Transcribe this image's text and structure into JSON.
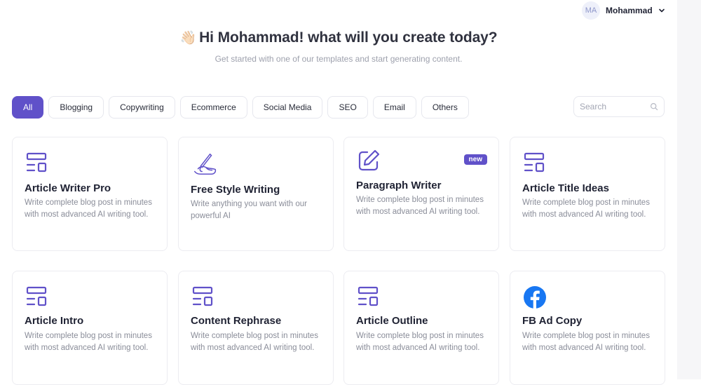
{
  "user": {
    "initials": "MA",
    "name": "Mohammad"
  },
  "header": {
    "title": "Hi Mohammad! what will you create today?",
    "subtitle": "Get started with one of our templates and start generating content."
  },
  "filters": {
    "items": [
      {
        "label": "All",
        "active": true
      },
      {
        "label": "Blogging"
      },
      {
        "label": "Copywriting"
      },
      {
        "label": "Ecommerce"
      },
      {
        "label": "Social Media"
      },
      {
        "label": "SEO"
      },
      {
        "label": "Email"
      },
      {
        "label": "Others"
      }
    ]
  },
  "search": {
    "placeholder": "Search"
  },
  "cards": [
    {
      "title": "Article Writer Pro",
      "description": "Write complete blog post in minutes with most advanced AI writing tool.",
      "icon": "layout-template-icon"
    },
    {
      "title": "Free Style Writing",
      "description": "Write anything you want with our powerful AI",
      "icon": "hand-writing-icon"
    },
    {
      "title": "Paragraph Writer",
      "description": "Write complete blog post in minutes with most advanced AI writing tool.",
      "icon": "edit-pencil-icon",
      "badge": "new"
    },
    {
      "title": "Article Title Ideas",
      "description": "Write complete blog post in minutes with most advanced AI writing tool.",
      "icon": "layout-template-icon"
    },
    {
      "title": "Article Intro",
      "description": "Write complete blog post in minutes with most advanced AI writing tool.",
      "icon": "layout-template-icon"
    },
    {
      "title": "Content Rephrase",
      "description": "Write complete blog post in minutes with most advanced AI writing tool.",
      "icon": "layout-template-icon"
    },
    {
      "title": "Article Outline",
      "description": "Write complete blog post in minutes with most advanced AI writing tool.",
      "icon": "layout-template-icon"
    },
    {
      "title": "FB Ad Copy",
      "description": "Write complete blog post in minutes with most advanced AI writing tool.",
      "icon": "facebook-icon"
    }
  ],
  "colors": {
    "accent": "#6051c9",
    "facebook": "#1877f2",
    "text": "#1f2233",
    "muted": "#8a8d99"
  }
}
